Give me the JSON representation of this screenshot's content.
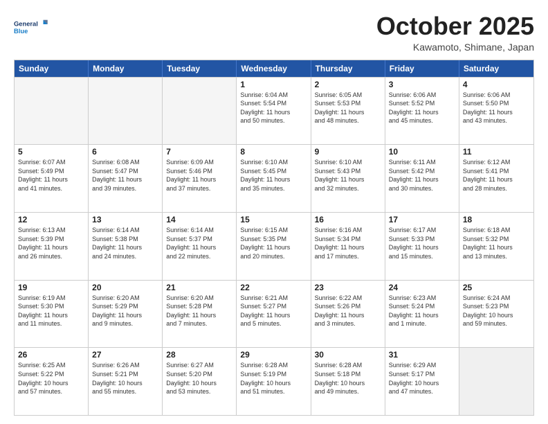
{
  "header": {
    "logo_line1": "General",
    "logo_line2": "Blue",
    "month": "October 2025",
    "location": "Kawamoto, Shimane, Japan"
  },
  "weekdays": [
    "Sunday",
    "Monday",
    "Tuesday",
    "Wednesday",
    "Thursday",
    "Friday",
    "Saturday"
  ],
  "rows": [
    [
      {
        "day": "",
        "text": ""
      },
      {
        "day": "",
        "text": ""
      },
      {
        "day": "",
        "text": ""
      },
      {
        "day": "1",
        "text": "Sunrise: 6:04 AM\nSunset: 5:54 PM\nDaylight: 11 hours\nand 50 minutes."
      },
      {
        "day": "2",
        "text": "Sunrise: 6:05 AM\nSunset: 5:53 PM\nDaylight: 11 hours\nand 48 minutes."
      },
      {
        "day": "3",
        "text": "Sunrise: 6:06 AM\nSunset: 5:52 PM\nDaylight: 11 hours\nand 45 minutes."
      },
      {
        "day": "4",
        "text": "Sunrise: 6:06 AM\nSunset: 5:50 PM\nDaylight: 11 hours\nand 43 minutes."
      }
    ],
    [
      {
        "day": "5",
        "text": "Sunrise: 6:07 AM\nSunset: 5:49 PM\nDaylight: 11 hours\nand 41 minutes."
      },
      {
        "day": "6",
        "text": "Sunrise: 6:08 AM\nSunset: 5:47 PM\nDaylight: 11 hours\nand 39 minutes."
      },
      {
        "day": "7",
        "text": "Sunrise: 6:09 AM\nSunset: 5:46 PM\nDaylight: 11 hours\nand 37 minutes."
      },
      {
        "day": "8",
        "text": "Sunrise: 6:10 AM\nSunset: 5:45 PM\nDaylight: 11 hours\nand 35 minutes."
      },
      {
        "day": "9",
        "text": "Sunrise: 6:10 AM\nSunset: 5:43 PM\nDaylight: 11 hours\nand 32 minutes."
      },
      {
        "day": "10",
        "text": "Sunrise: 6:11 AM\nSunset: 5:42 PM\nDaylight: 11 hours\nand 30 minutes."
      },
      {
        "day": "11",
        "text": "Sunrise: 6:12 AM\nSunset: 5:41 PM\nDaylight: 11 hours\nand 28 minutes."
      }
    ],
    [
      {
        "day": "12",
        "text": "Sunrise: 6:13 AM\nSunset: 5:39 PM\nDaylight: 11 hours\nand 26 minutes."
      },
      {
        "day": "13",
        "text": "Sunrise: 6:14 AM\nSunset: 5:38 PM\nDaylight: 11 hours\nand 24 minutes."
      },
      {
        "day": "14",
        "text": "Sunrise: 6:14 AM\nSunset: 5:37 PM\nDaylight: 11 hours\nand 22 minutes."
      },
      {
        "day": "15",
        "text": "Sunrise: 6:15 AM\nSunset: 5:35 PM\nDaylight: 11 hours\nand 20 minutes."
      },
      {
        "day": "16",
        "text": "Sunrise: 6:16 AM\nSunset: 5:34 PM\nDaylight: 11 hours\nand 17 minutes."
      },
      {
        "day": "17",
        "text": "Sunrise: 6:17 AM\nSunset: 5:33 PM\nDaylight: 11 hours\nand 15 minutes."
      },
      {
        "day": "18",
        "text": "Sunrise: 6:18 AM\nSunset: 5:32 PM\nDaylight: 11 hours\nand 13 minutes."
      }
    ],
    [
      {
        "day": "19",
        "text": "Sunrise: 6:19 AM\nSunset: 5:30 PM\nDaylight: 11 hours\nand 11 minutes."
      },
      {
        "day": "20",
        "text": "Sunrise: 6:20 AM\nSunset: 5:29 PM\nDaylight: 11 hours\nand 9 minutes."
      },
      {
        "day": "21",
        "text": "Sunrise: 6:20 AM\nSunset: 5:28 PM\nDaylight: 11 hours\nand 7 minutes."
      },
      {
        "day": "22",
        "text": "Sunrise: 6:21 AM\nSunset: 5:27 PM\nDaylight: 11 hours\nand 5 minutes."
      },
      {
        "day": "23",
        "text": "Sunrise: 6:22 AM\nSunset: 5:26 PM\nDaylight: 11 hours\nand 3 minutes."
      },
      {
        "day": "24",
        "text": "Sunrise: 6:23 AM\nSunset: 5:24 PM\nDaylight: 11 hours\nand 1 minute."
      },
      {
        "day": "25",
        "text": "Sunrise: 6:24 AM\nSunset: 5:23 PM\nDaylight: 10 hours\nand 59 minutes."
      }
    ],
    [
      {
        "day": "26",
        "text": "Sunrise: 6:25 AM\nSunset: 5:22 PM\nDaylight: 10 hours\nand 57 minutes."
      },
      {
        "day": "27",
        "text": "Sunrise: 6:26 AM\nSunset: 5:21 PM\nDaylight: 10 hours\nand 55 minutes."
      },
      {
        "day": "28",
        "text": "Sunrise: 6:27 AM\nSunset: 5:20 PM\nDaylight: 10 hours\nand 53 minutes."
      },
      {
        "day": "29",
        "text": "Sunrise: 6:28 AM\nSunset: 5:19 PM\nDaylight: 10 hours\nand 51 minutes."
      },
      {
        "day": "30",
        "text": "Sunrise: 6:28 AM\nSunset: 5:18 PM\nDaylight: 10 hours\nand 49 minutes."
      },
      {
        "day": "31",
        "text": "Sunrise: 6:29 AM\nSunset: 5:17 PM\nDaylight: 10 hours\nand 47 minutes."
      },
      {
        "day": "",
        "text": ""
      }
    ]
  ]
}
